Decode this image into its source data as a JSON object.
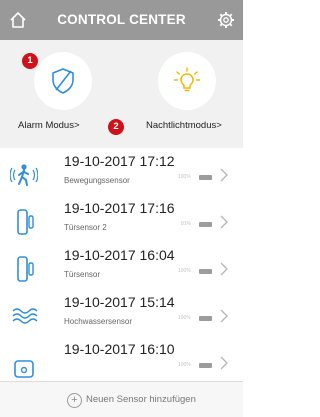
{
  "header": {
    "title": "CONTROL CENTER"
  },
  "modes": {
    "alarm": {
      "label": "Alarm Modus>",
      "badge": "1"
    },
    "nightlight": {
      "label": "Nachtlichtmodus>"
    },
    "label_badge": "2"
  },
  "sensors": [
    {
      "timestamp": "19-10-2017 17:12",
      "name": "Bewegungssensor",
      "battery": "100%",
      "icon": "motion-sensor-icon"
    },
    {
      "timestamp": "19-10-2017 17:16",
      "name": "Türsensor 2",
      "battery": "81%",
      "icon": "door-sensor-icon"
    },
    {
      "timestamp": "19-10-2017 16:04",
      "name": "Türsensor",
      "battery": "100%",
      "icon": "door-sensor-icon"
    },
    {
      "timestamp": "19-10-2017 15:14",
      "name": "Hochwassersensor",
      "battery": "100%",
      "icon": "water-sensor-icon"
    },
    {
      "timestamp": "19-10-2017 16:10",
      "name": "",
      "battery": "100%",
      "icon": "sensor-icon"
    }
  ],
  "footer": {
    "add_label": "Neuen Sensor hinzufügen"
  },
  "colors": {
    "header_bg": "#999999",
    "accent_blue": "#2f8fd8",
    "nightlight_yellow": "#f2b800",
    "badge_red": "#d0101b"
  }
}
